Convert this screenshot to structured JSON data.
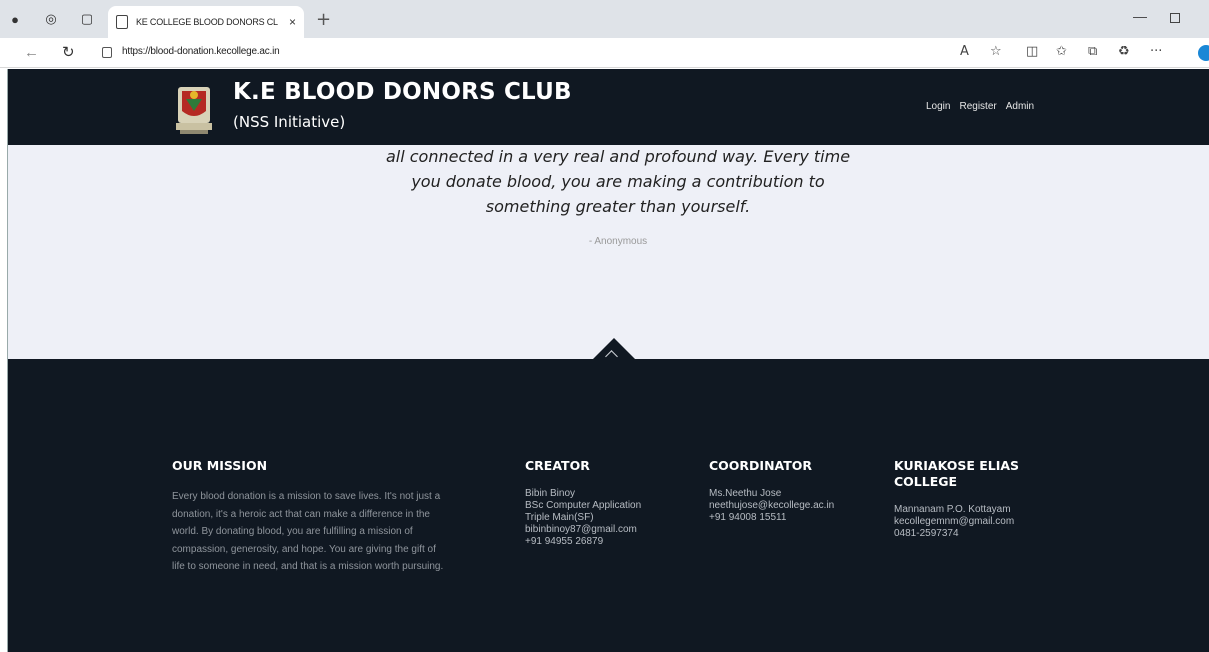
{
  "browser": {
    "tab_title": "KE COLLEGE BLOOD DONORS CL",
    "tab_close": "×",
    "new_tab": "+",
    "url": "https://blood-donation.kecollege.ac.in"
  },
  "site": {
    "title": "K.E BLOOD DONORS CLUB",
    "subtitle": "(NSS Initiative)",
    "nav": {
      "login": "Login",
      "register": "Register",
      "admin": "Admin"
    }
  },
  "quote": {
    "lines": [
      "all connected in a very real and profound way. Every time",
      "you donate blood, you are making a contribution to",
      "something greater than yourself."
    ],
    "author": "- Anonymous"
  },
  "footer": {
    "mission": {
      "heading": "OUR MISSION",
      "text": "Every blood donation is a mission to save lives. It's not just a donation, it's a heroic act that can make a difference in the world. By donating blood, you are fulfilling a mission of compassion, generosity, and hope. You are giving the gift of life to someone in need, and that is a mission worth pursuing."
    },
    "creator": {
      "heading": "CREATOR",
      "lines": [
        "Bibin Binoy",
        "BSc Computer Application",
        "Triple Main(SF)",
        "bibinbinoy87@gmail.com",
        "+91 94955 26879"
      ]
    },
    "coordinator": {
      "heading": "COORDINATOR",
      "lines": [
        "Ms.Neethu Jose",
        "neethujose@kecollege.ac.in",
        "+91 94008 15511"
      ]
    },
    "college": {
      "heading": "KURIAKOSE ELIAS COLLEGE",
      "lines": [
        "Mannanam P.O. Kottayam",
        "kecollegemnm@gmail.com",
        "0481-2597374"
      ]
    }
  }
}
